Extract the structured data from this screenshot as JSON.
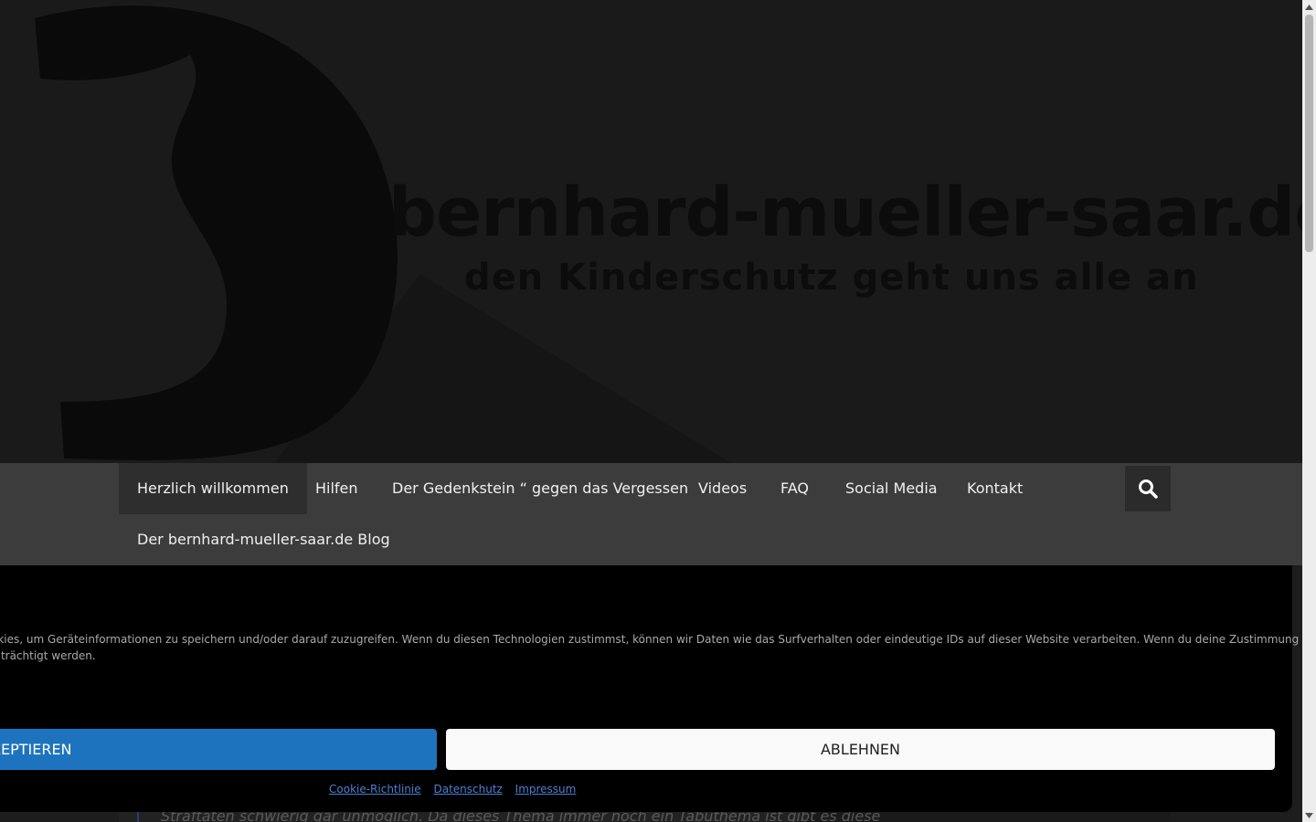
{
  "header": {
    "site_title": "bernhard-mueller-saar.de",
    "tagline": "den Kinderschutz geht uns alle an"
  },
  "nav": {
    "items": [
      {
        "label": "Herzlich willkommen",
        "active": true
      },
      {
        "label": "Hilfen",
        "active": false
      },
      {
        "label": "Der Gedenkstein “ gegen das Vergessen",
        "active": false
      },
      {
        "label": "Videos",
        "active": false
      },
      {
        "label": "FAQ",
        "active": false
      },
      {
        "label": "Social Media",
        "active": false
      },
      {
        "label": "Kontakt",
        "active": false
      },
      {
        "label": "Der bernhard-mueller-saar.de Blog",
        "active": false
      }
    ],
    "search_icon": "search-icon"
  },
  "content": {
    "text_fragment": "Straftaten schwierig gar unmöglich. Da dieses Thema immer noch ein Tabuthema ist gibt es diese"
  },
  "cookie_banner": {
    "text_line1": "okies, um Geräteinformationen zu speichern und/oder darauf zuzugreifen. Wenn du diesen Technologien zustimmst, können wir Daten wie das Surfverhalten oder eindeutige IDs auf dieser Website verarbeiten. Wenn du deine Zustimmung nicht",
    "text_line2": "inträchtigt werden.",
    "accept_label": "ZEPTIEREN",
    "deny_label": "ABLEHNEN",
    "links": [
      "Cookie-Richtlinie",
      "Datenschutz",
      "Impressum"
    ]
  },
  "colors": {
    "accept_button": "#1e73be",
    "deny_button": "#f9f9f9",
    "link": "#4c7fd1",
    "nav_bg": "#3c3c3c"
  }
}
